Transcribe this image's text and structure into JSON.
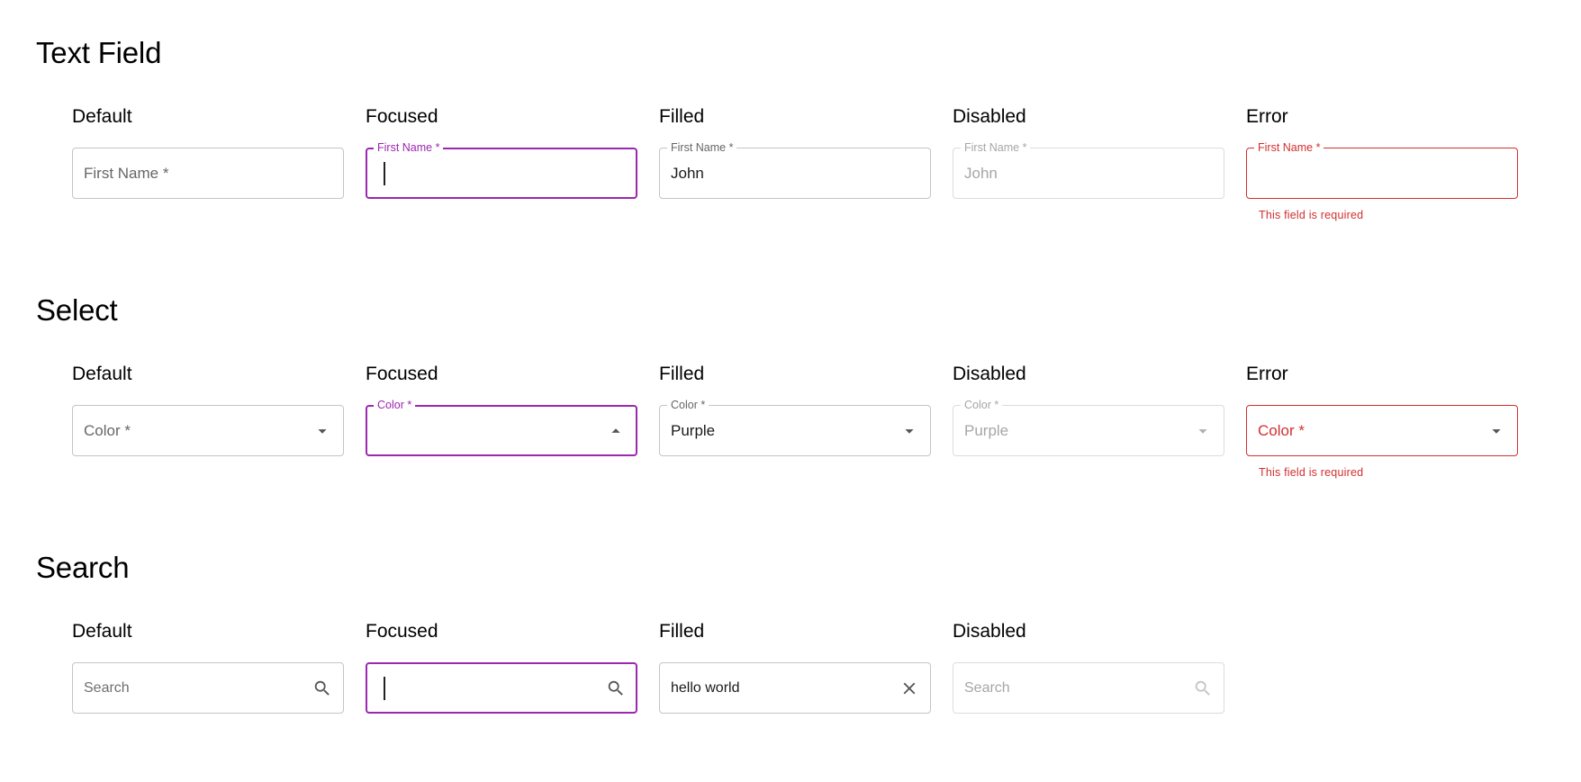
{
  "text_field": {
    "title": "Text Field",
    "default": {
      "state": "Default",
      "placeholder": "First Name *"
    },
    "focused": {
      "state": "Focused",
      "label": "First Name *"
    },
    "filled": {
      "state": "Filled",
      "label": "First Name *",
      "value": "John"
    },
    "disabled": {
      "state": "Disabled",
      "label": "First Name *",
      "value": "John"
    },
    "error": {
      "state": "Error",
      "label": "First Name *",
      "helper": "This field is required"
    }
  },
  "select": {
    "title": "Select",
    "default": {
      "state": "Default",
      "placeholder": "Color *"
    },
    "focused": {
      "state": "Focused",
      "label": "Color *"
    },
    "filled": {
      "state": "Filled",
      "label": "Color *",
      "value": "Purple"
    },
    "disabled": {
      "state": "Disabled",
      "label": "Color *",
      "value": "Purple"
    },
    "error": {
      "state": "Error",
      "placeholder": "Color *",
      "helper": "This field is required"
    }
  },
  "search": {
    "title": "Search",
    "default": {
      "state": "Default",
      "placeholder": "Search"
    },
    "focused": {
      "state": "Focused"
    },
    "filled": {
      "state": "Filled",
      "value": "hello world"
    },
    "disabled": {
      "state": "Disabled",
      "placeholder": "Search"
    }
  },
  "colors": {
    "focus": "#9c27b0",
    "error": "#d32f2f",
    "border": "#c4c4c4",
    "disabled": "#a6a6a6"
  },
  "icons": {
    "dropdown": "arrow-drop-down-icon",
    "dropup": "arrow-drop-up-icon",
    "search": "search-icon",
    "clear": "close-icon"
  }
}
